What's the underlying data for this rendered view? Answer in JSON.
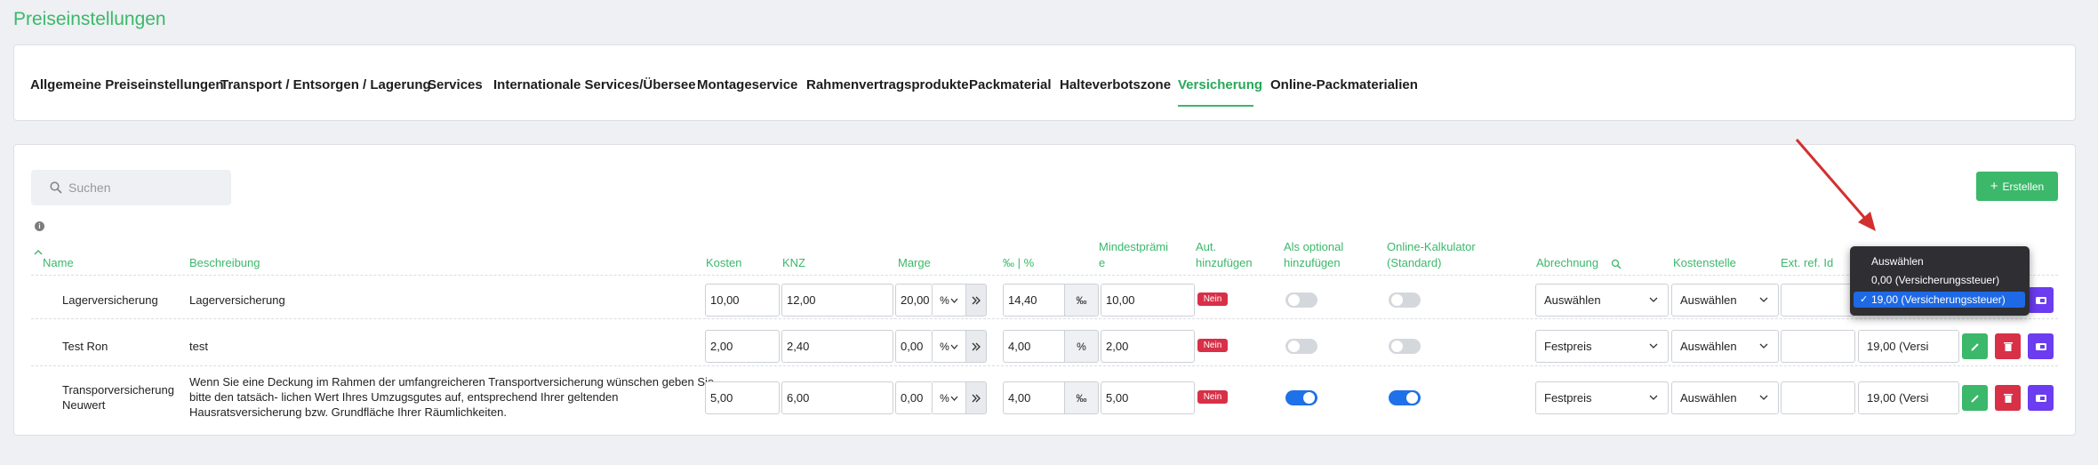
{
  "page_title": "Preiseinstellungen",
  "tabs": [
    {
      "label": "Allgemeine Preiseinstellungen",
      "active": false
    },
    {
      "label": "Transport / Entsorgen / Lagerung",
      "active": false
    },
    {
      "label": "Services",
      "active": false
    },
    {
      "label": "Internationale Services/Übersee",
      "active": false
    },
    {
      "label": "Montageservice",
      "active": false
    },
    {
      "label": "Rahmenvertragsprodukte",
      "active": false
    },
    {
      "label": "Packmaterial",
      "active": false
    },
    {
      "label": "Halteverbotszone",
      "active": false
    },
    {
      "label": "Versicherung",
      "active": true
    },
    {
      "label": "Online-Packmaterialien",
      "active": false
    }
  ],
  "search": {
    "placeholder": "Suchen"
  },
  "create_button": {
    "label": "Erstellen"
  },
  "columns": {
    "name": "Name",
    "beschreibung": "Beschreibung",
    "kosten": "Kosten",
    "knz": "KNZ",
    "marge": "Marge",
    "permille_percent": "‰ | %",
    "mindestpraemie_line1": "Mindestprämi",
    "mindestpraemie_line2": "e",
    "aut_hinzufuegen_line1": "Aut.",
    "aut_hinzufuegen_line2": "hinzufügen",
    "als_optional_line1": "Als optional",
    "als_optional_line2": "hinzufügen",
    "online_kalkulator_line1": "Online-Kalkulator",
    "online_kalkulator_line2": "(Standard)",
    "abrechnung": "Abrechnung",
    "kostenstelle": "Kostenstelle",
    "ext_ref_id": "Ext. ref. Id"
  },
  "rows": [
    {
      "name": "Lagerversicherung",
      "beschreibung": "Lagerversicherung",
      "kosten": "10,00",
      "knz": "12,00",
      "marge": "20,00",
      "marge_unit": "%",
      "rate": "14,40",
      "rate_unit": "‰",
      "mindestpraemie": "10,00",
      "aut_hinzufuegen": "Nein",
      "als_optional": false,
      "online_kalkulator": false,
      "abrechnung": "Auswählen",
      "kostenstelle": "Auswählen",
      "ext_ref_id": "",
      "steuer": "19,00 (Versicherungssteuer)"
    },
    {
      "name": "Test Ron",
      "beschreibung": "test",
      "kosten": "2,00",
      "knz": "2,40",
      "marge": "0,00",
      "marge_unit": "%",
      "rate": "4,00",
      "rate_unit": "%",
      "mindestpraemie": "2,00",
      "aut_hinzufuegen": "Nein",
      "als_optional": false,
      "online_kalkulator": false,
      "abrechnung": "Festpreis",
      "kostenstelle": "Auswählen",
      "ext_ref_id": "",
      "steuer": "19,00 (Versi"
    },
    {
      "name_line1": "Transporversicherung",
      "name_line2": "Neuwert",
      "beschreibung_line1": "Wenn Sie eine Deckung im Rahmen der umfangreicheren Transportversicherung wünschen geben Sie",
      "beschreibung_line2": "bitte den tatsäch- lichen Wert Ihres Umzugsgutes auf, entsprechend Ihrer geltenden",
      "beschreibung_line3": "Hausratsversicherung bzw. Grundfläche Ihrer Räumlichkeiten.",
      "kosten": "5,00",
      "knz": "6,00",
      "marge": "0,00",
      "marge_unit": "%",
      "rate": "4,00",
      "rate_unit": "‰",
      "mindestpraemie": "5,00",
      "aut_hinzufuegen": "Nein",
      "als_optional": true,
      "online_kalkulator": true,
      "abrechnung": "Festpreis",
      "kostenstelle": "Auswählen",
      "ext_ref_id": "",
      "steuer": "19,00 (Versi"
    }
  ],
  "steuer_dropdown": {
    "options": [
      "Auswählen",
      "0,00 (Versicherungssteuer)",
      "19,00 (Versicherungssteuer)"
    ],
    "selected_index": 2
  },
  "colors": {
    "accent": "#3bb86a",
    "danger": "#d83047",
    "purple": "#6b3cf0",
    "toggle_on": "#1e71e8",
    "annotation_arrow": "#d32f2f"
  }
}
